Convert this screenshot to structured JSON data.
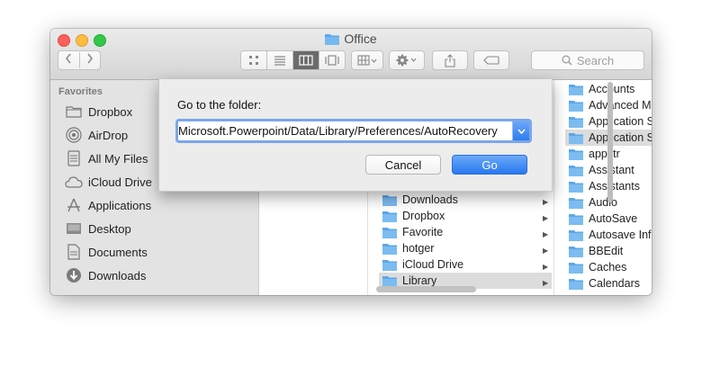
{
  "window": {
    "title": "Office",
    "search_placeholder": "Search"
  },
  "sidebar": {
    "header": "Favorites",
    "items": [
      {
        "label": "Dropbox",
        "icon": "folder-icon"
      },
      {
        "label": "AirDrop",
        "icon": "airdrop-icon"
      },
      {
        "label": "All My Files",
        "icon": "all-files-icon"
      },
      {
        "label": "iCloud Drive",
        "icon": "cloud-icon"
      },
      {
        "label": "Applications",
        "icon": "applications-icon"
      },
      {
        "label": "Desktop",
        "icon": "desktop-icon"
      },
      {
        "label": "Documents",
        "icon": "documents-icon"
      },
      {
        "label": "Downloads",
        "icon": "downloads-icon"
      }
    ]
  },
  "column2": {
    "items": [
      "Downloads",
      "Dropbox",
      "Favorite",
      "hotger",
      "iCloud Drive",
      "Library"
    ]
  },
  "column3": {
    "items": [
      "Accounts",
      "Advanced M",
      "Application S",
      "Application S",
      "appstr",
      "Assistant",
      "Assistants",
      "Audio",
      "AutoSave",
      "Autosave Inf",
      "BBEdit",
      "Caches",
      "Calendars"
    ]
  },
  "dialog": {
    "prompt": "Go to the folder:",
    "path_value": "Microsoft.Powerpoint/Data/Library/Preferences/AutoRecovery",
    "cancel_label": "Cancel",
    "go_label": "Go"
  },
  "colors": {
    "accent": "#2f7bf0",
    "folder_blue": "#5aa7e8",
    "selection_gray": "#dcdcdc"
  }
}
